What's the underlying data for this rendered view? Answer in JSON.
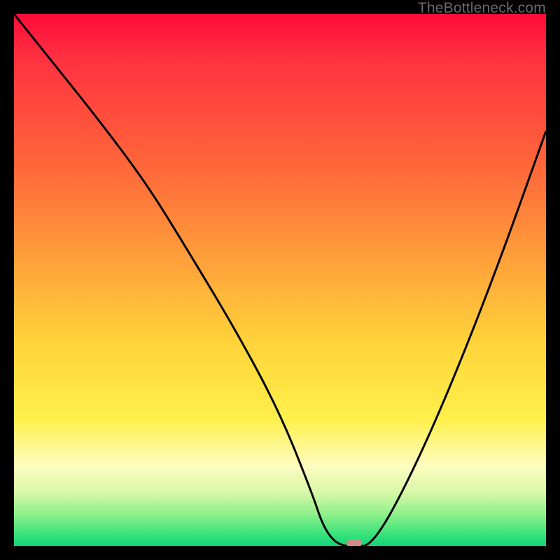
{
  "watermark": "TheBottleneck.com",
  "colors": {
    "background": "#000000",
    "curve_stroke": "#000000",
    "marker": "#cf8b86"
  },
  "chart_data": {
    "type": "line",
    "title": "",
    "xlabel": "",
    "ylabel": "",
    "xlim": [
      0,
      100
    ],
    "ylim": [
      0,
      100
    ],
    "grid": false,
    "legend": false,
    "series": [
      {
        "name": "curve",
        "x": [
          0,
          8,
          16,
          25,
          33,
          42,
          50,
          56,
          58,
          60,
          62,
          64,
          67,
          72,
          80,
          90,
          100
        ],
        "y": [
          100,
          90,
          80,
          68,
          55,
          40,
          25,
          10,
          4,
          1,
          0,
          0,
          0,
          8,
          25,
          50,
          78
        ]
      }
    ],
    "marker": {
      "x": 64,
      "y": 0
    }
  }
}
